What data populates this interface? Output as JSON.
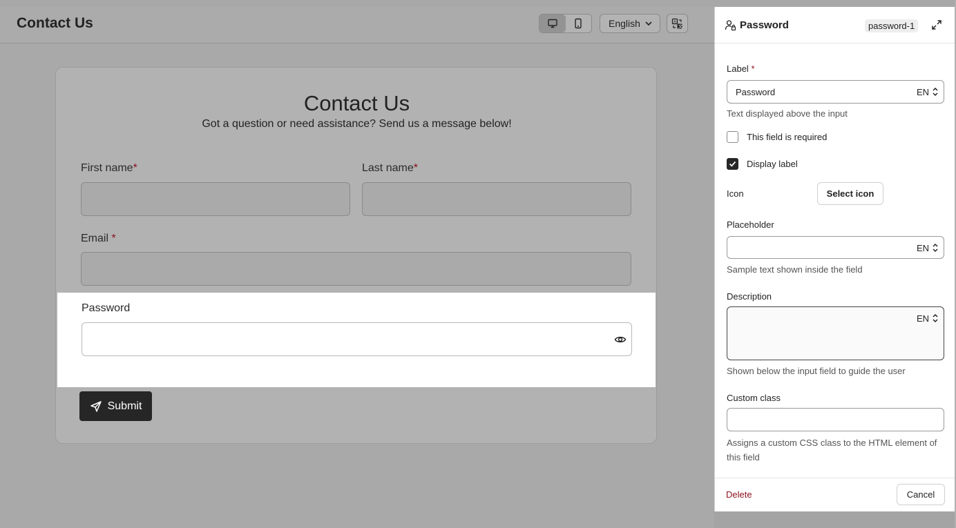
{
  "header": {
    "title": "Contact Us",
    "view_desktop_icon": "monitor-icon",
    "view_mobile_icon": "phone-icon",
    "language": "English",
    "translate_icon": "translate-icon"
  },
  "form": {
    "title": "Contact Us",
    "subtitle": "Got a question or need assistance? Send us a message below!",
    "first_name_label": "First name",
    "last_name_label": "Last name",
    "email_label": "Email",
    "required_mark": "*",
    "password_label": "Password",
    "submit_label": "Submit"
  },
  "panel": {
    "title": "Password",
    "field_id": "password-1",
    "label_title": "Label",
    "label_required_mark": "*",
    "label_value": "Password",
    "lang_code": "EN",
    "label_help": "Text displayed above the input",
    "required_checkbox_label": "This field is required",
    "required_checked": false,
    "display_label_checkbox_label": "Display label",
    "display_label_checked": true,
    "icon_title": "Icon",
    "select_icon_label": "Select icon",
    "placeholder_title": "Placeholder",
    "placeholder_value": "",
    "placeholder_help": "Sample text shown inside the field",
    "description_title": "Description",
    "description_value": "",
    "description_help": "Shown below the input field to guide the user",
    "custom_class_title": "Custom class",
    "custom_class_value": "",
    "custom_class_help": "Assigns a custom CSS class to the HTML element of this field",
    "delete_label": "Delete",
    "cancel_label": "Cancel"
  },
  "colors": {
    "accent_dark": "#262626",
    "required_red": "#8b0f1c",
    "overlay_gray": "#a9a9a9"
  }
}
